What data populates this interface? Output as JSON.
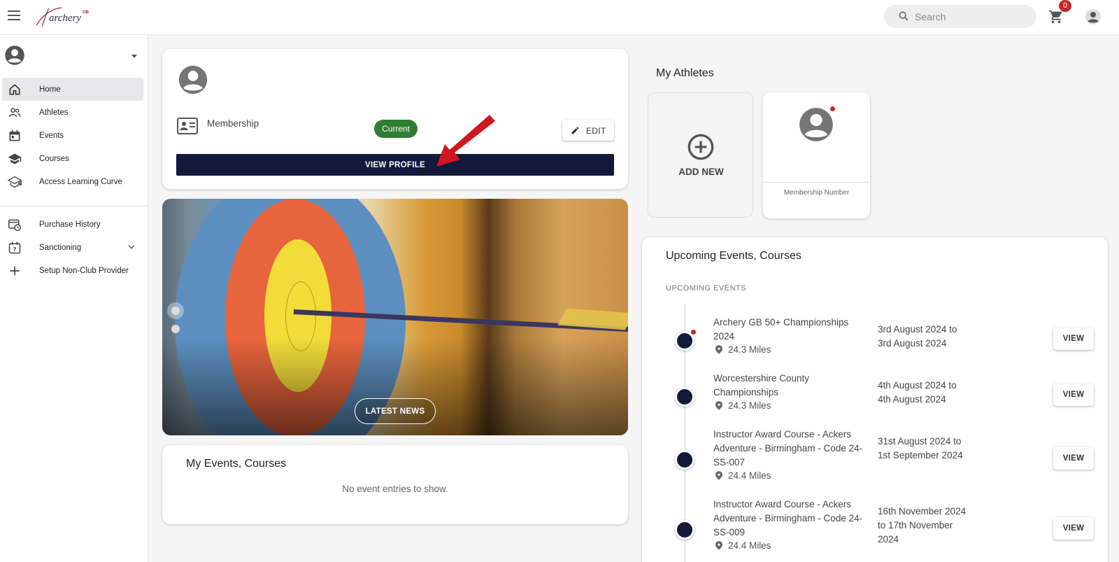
{
  "header": {
    "logo_text": "archery",
    "logo_sup": "GB",
    "search_placeholder": "Search",
    "cart_count": "0",
    "colors": {
      "badge": "#c62828",
      "primary": "#12193a"
    }
  },
  "sidebar": {
    "items": [
      {
        "label": "Home",
        "icon": "home-icon",
        "active": true
      },
      {
        "label": "Athletes",
        "icon": "people-icon"
      },
      {
        "label": "Events",
        "icon": "calendar-icon"
      },
      {
        "label": "Courses",
        "icon": "school-icon"
      },
      {
        "label": "Access Learning Curve",
        "icon": "school-outline-icon"
      },
      {
        "label": "Purchase History",
        "icon": "history-icon"
      },
      {
        "label": "Sanctioning",
        "icon": "calendar-question-icon",
        "expandable": true
      },
      {
        "label": "Setup Non-Club Provider",
        "icon": "plus-icon"
      }
    ]
  },
  "profile": {
    "membership_label": "Membership",
    "status": "Current",
    "edit_label": "EDIT",
    "view_profile_label": "VIEW PROFILE"
  },
  "banner": {
    "latest_news_label": "LATEST NEWS"
  },
  "my_events": {
    "title": "My Events, Courses",
    "empty_text": "No event entries to show."
  },
  "athletes": {
    "title": "My Athletes",
    "add_new_label": "ADD NEW",
    "membership_number_label": "Membership Number"
  },
  "upcoming": {
    "title": "Upcoming Events, Courses",
    "subtitle": "UPCOMING EVENTS",
    "view_label": "VIEW",
    "events": [
      {
        "name": "Archery GB 50+ Championships 2024",
        "distance": "24.3 Miles",
        "dates": "3rd August 2024 to 3rd August 2024"
      },
      {
        "name": "Worcestershire County Championships",
        "distance": "24.3 Miles",
        "dates": "4th August 2024 to 4th August 2024"
      },
      {
        "name": "Instructor Award Course - Ackers Adventure - Birmingham - Code 24-SS-007",
        "distance": "24.4 Miles",
        "dates": "31st August 2024 to 1st September 2024"
      },
      {
        "name": "Instructor Award Course - Ackers Adventure - Birmingham - Code 24-SS-009",
        "distance": "24.4 Miles",
        "dates": "16th November 2024 to 17th November 2024"
      }
    ]
  }
}
